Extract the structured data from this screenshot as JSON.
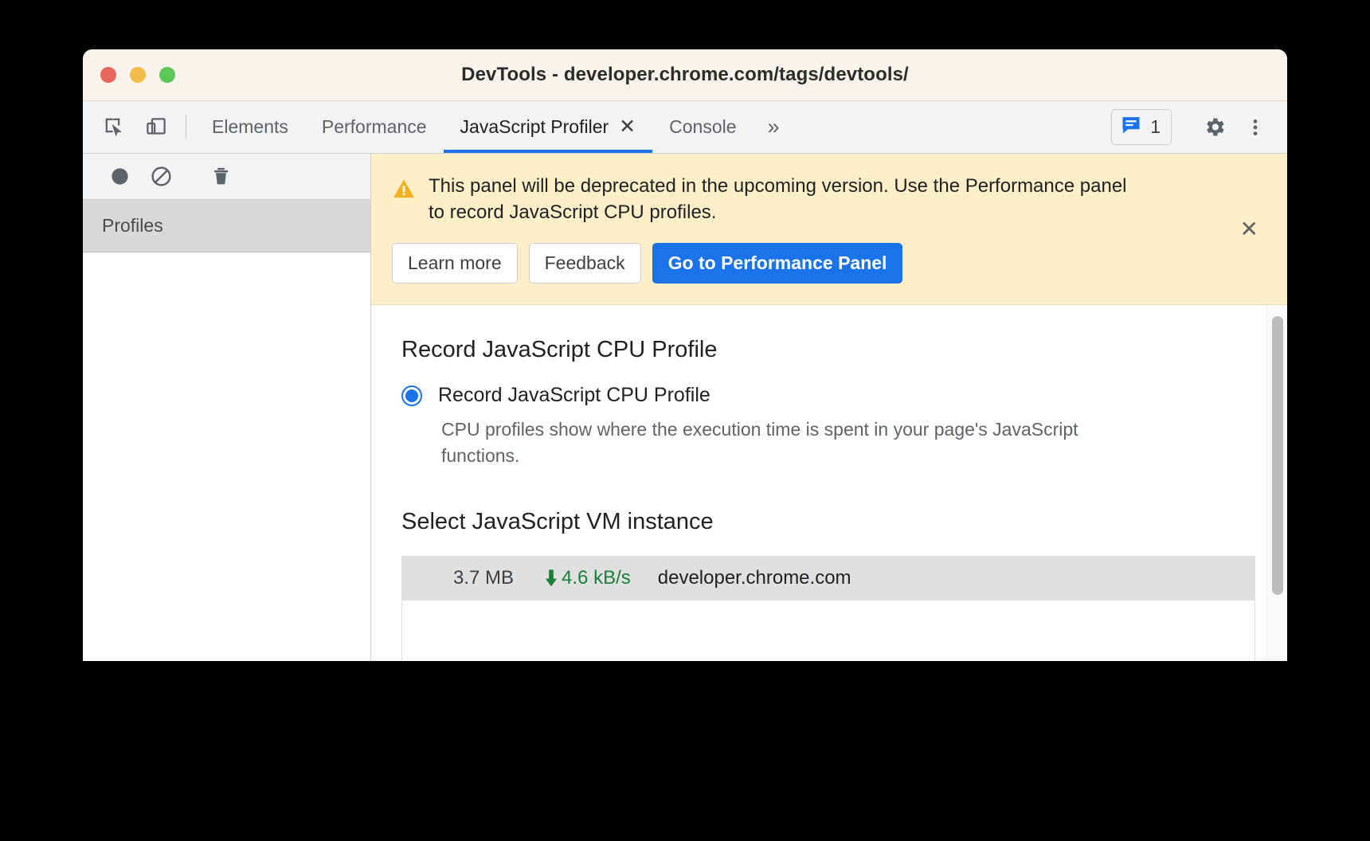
{
  "window": {
    "title": "DevTools - developer.chrome.com/tags/devtools/",
    "traffic_lights": [
      "close",
      "minimize",
      "maximize"
    ],
    "colors": {
      "close": "#e8685e",
      "minimize": "#f2bc4b",
      "maximize": "#5ec75a"
    }
  },
  "tabbar": {
    "inspect_icon": "inspect-cursor-icon",
    "device_toggle_icon": "device-toolbar-icon",
    "tabs": [
      {
        "label": "Elements",
        "active": false,
        "closable": false
      },
      {
        "label": "Performance",
        "active": false,
        "closable": false
      },
      {
        "label": "JavaScript Profiler",
        "active": true,
        "closable": true,
        "close_glyph": "✕"
      },
      {
        "label": "Console",
        "active": false,
        "closable": false
      }
    ],
    "more_tabs_glyph": "»",
    "message_count": "1",
    "message_icon": "message-bubble-icon",
    "settings_icon": "gear-icon",
    "more_options_icon": "kebab-menu-icon",
    "accent": "#1a73e8"
  },
  "sidebar": {
    "toolbar": {
      "record_icon": "record-circle-icon",
      "clear_icon": "no-entry-clear-icon",
      "delete_icon": "trash-icon"
    },
    "header": "Profiles",
    "items": []
  },
  "banner": {
    "warning_icon": "warning-triangle-icon",
    "message": "This panel will be deprecated in the upcoming version. Use the Performance panel to record JavaScript CPU profiles.",
    "buttons": [
      {
        "label": "Learn more",
        "primary": false
      },
      {
        "label": "Feedback",
        "primary": false
      },
      {
        "label": "Go to Performance Panel",
        "primary": true
      }
    ],
    "close_glyph": "✕",
    "background": "#fdf0c8",
    "primary_color": "#1a73e8"
  },
  "main": {
    "record_section_title": "Record JavaScript CPU Profile",
    "radio": {
      "label": "Record JavaScript CPU Profile",
      "selected": true,
      "description": "CPU profiles show where the execution time is spent in your page's JavaScript functions."
    },
    "vm_section_title": "Select JavaScript VM instance",
    "vm_instances": [
      {
        "size": "3.7 MB",
        "speed": "4.6 kB/s",
        "speed_icon": "download-arrow-icon",
        "speed_color": "#188038",
        "host": "developer.chrome.com",
        "selected": true
      }
    ]
  }
}
